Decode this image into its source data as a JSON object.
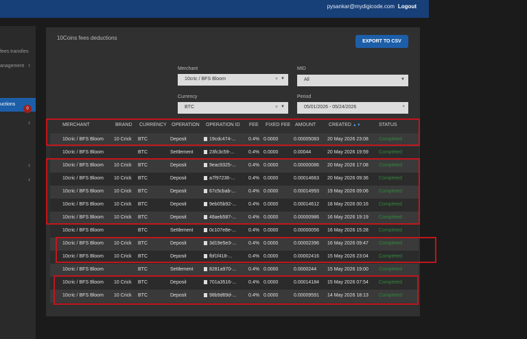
{
  "header": {
    "email": "pysankar@mydigicode.com",
    "logout": "Logout"
  },
  "sidebar": {
    "items": [
      {
        "label": "fees transfies"
      },
      {
        "label": "anagement"
      },
      {
        "label": "uctions"
      }
    ],
    "badge": "0"
  },
  "page": {
    "title": "10Coins fees deductions",
    "export_label": "EXPORT TO CSV"
  },
  "filters": {
    "merchant": {
      "label": "Merchant",
      "value": "10cric / BFS Bloom"
    },
    "mid": {
      "label": "MID",
      "value": "All"
    },
    "currency": {
      "label": "Currency",
      "value": "BTC"
    },
    "period": {
      "label": "Period",
      "value": "05/01/2026 - 05/24/2026"
    }
  },
  "table": {
    "columns": [
      "MERCHANT",
      "BRAND",
      "CURRENCY",
      "OPERATION",
      "OPERATION ID",
      "FEE",
      "FIXED FEE",
      "AMOUNT",
      "CREATED",
      "STATUS"
    ],
    "rows": [
      {
        "merchant": "10cric / BFS Bloom",
        "brand": "10 Crick",
        "currency": "BTC",
        "operation": "Deposit",
        "opid": "19cdc474-...",
        "fee": "0.4%",
        "fixed": "0.0000",
        "amount": "0.00005083",
        "created": "20 May 2026 23:08",
        "status": "Completed"
      },
      {
        "merchant": "10cric / BFS Bloom",
        "brand": "",
        "currency": "BTC",
        "operation": "Settlement",
        "opid": "23fc3c59-...",
        "fee": "0.4%",
        "fixed": "0.0000",
        "amount": "0.00044",
        "created": "20 May 2026 19:59",
        "status": "Completed"
      },
      {
        "merchant": "10cric / BFS Bloom",
        "brand": "10 Crick",
        "currency": "BTC",
        "operation": "Deposit",
        "opid": "9eac9325-...",
        "fee": "0.4%",
        "fixed": "0.0000",
        "amount": "0.00000086",
        "created": "20 May 2026 17:08",
        "status": "Completed"
      },
      {
        "merchant": "10cric / BFS Bloom",
        "brand": "10 Crick",
        "currency": "BTC",
        "operation": "Deposit",
        "opid": "a7f97236-...",
        "fee": "0.4%",
        "fixed": "0.0000",
        "amount": "0.00014663",
        "created": "20 May 2026 09:36",
        "status": "Completed"
      },
      {
        "merchant": "10cric / BFS Bloom",
        "brand": "10 Crick",
        "currency": "BTC",
        "operation": "Deposit",
        "opid": "67c5cbab-...",
        "fee": "0.4%",
        "fixed": "0.0000",
        "amount": "0.00014993",
        "created": "19 May 2026 09:06",
        "status": "Completed"
      },
      {
        "merchant": "10cric / BFS Bloom",
        "brand": "10 Crick",
        "currency": "BTC",
        "operation": "Deposit",
        "opid": "9eb05b92-...",
        "fee": "0.4%",
        "fixed": "0.0000",
        "amount": "0.00014612",
        "created": "18 May 2026 00:16",
        "status": "Completed"
      },
      {
        "merchant": "10cric / BFS Bloom",
        "brand": "10 Crick",
        "currency": "BTC",
        "operation": "Deposit",
        "opid": "48aeb587-...",
        "fee": "0.4%",
        "fixed": "0.0000",
        "amount": "0.00000986",
        "created": "16 May 2026 19:19",
        "status": "Completed"
      },
      {
        "merchant": "10cric / BFS Bloom",
        "brand": "",
        "currency": "BTC",
        "operation": "Settlement",
        "opid": "0c107e8e-...",
        "fee": "0.4%",
        "fixed": "0.0000",
        "amount": "0.00000056",
        "created": "16 May 2026 15:28",
        "status": "Completed"
      },
      {
        "merchant": "10cric / BFS Bloom",
        "brand": "10 Crick",
        "currency": "BTC",
        "operation": "Deposit",
        "opid": "3d19e5e3-...",
        "fee": "0.4%",
        "fixed": "0.0000",
        "amount": "0.00002396",
        "created": "16 May 2026 09:47",
        "status": "Completed"
      },
      {
        "merchant": "10cric / BFS Bloom",
        "brand": "10 Crick",
        "currency": "BTC",
        "operation": "Deposit",
        "opid": "fbf1f418-...",
        "fee": "0.4%",
        "fixed": "0.0000",
        "amount": "0.00002416",
        "created": "15 May 2026 23:04",
        "status": "Completed"
      },
      {
        "merchant": "10cric / BFS Bloom",
        "brand": "",
        "currency": "BTC",
        "operation": "Settlement",
        "opid": "8281a970-...",
        "fee": "0.4%",
        "fixed": "0.0000",
        "amount": "0.0000244",
        "created": "15 May 2026 19:00",
        "status": "Completed"
      },
      {
        "merchant": "10cric / BFS Bloom",
        "brand": "10 Crick",
        "currency": "BTC",
        "operation": "Deposit",
        "opid": "701a3516-...",
        "fee": "0.4%",
        "fixed": "0.0000",
        "amount": "0.00014184",
        "created": "15 May 2026 07:54",
        "status": "Completed"
      },
      {
        "merchant": "10cric / BFS Bloom",
        "brand": "10 Crick",
        "currency": "BTC",
        "operation": "Deposit",
        "opid": "98b9d69d-...",
        "fee": "0.4%",
        "fixed": "0.0000",
        "amount": "0.00009591",
        "created": "14 May 2026 18:13",
        "status": "Completed"
      }
    ]
  },
  "colors": {
    "highlight": "#c4151c",
    "accent": "#1d5ea8",
    "status_completed": "#2e8b3a"
  }
}
